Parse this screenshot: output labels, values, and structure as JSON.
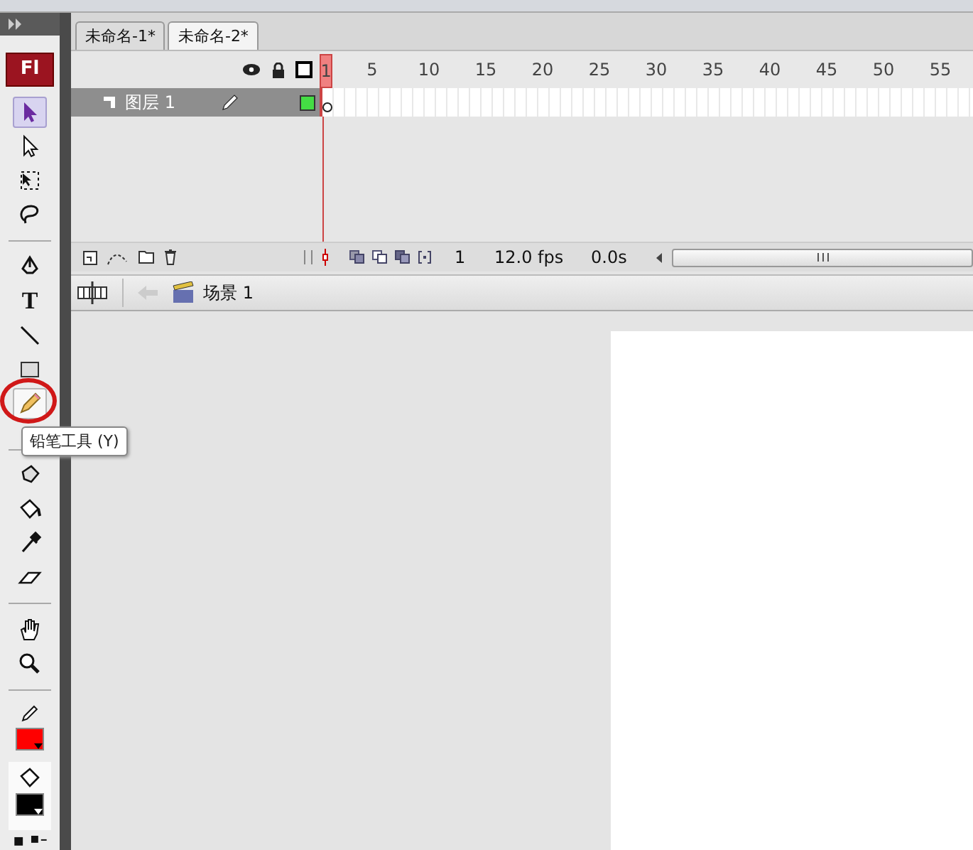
{
  "app_logo": "Fl",
  "tabs": [
    {
      "label": "未命名-1*",
      "selected": false
    },
    {
      "label": "未命名-2*",
      "selected": true
    }
  ],
  "timeline": {
    "frame_numbers": [
      "1",
      "5",
      "10",
      "15",
      "20",
      "25",
      "30",
      "35",
      "40",
      "45",
      "50",
      "55"
    ],
    "layers": [
      {
        "name": "图层 1",
        "selected": true,
        "color": "#44dd44"
      }
    ],
    "current_frame": "1",
    "frame_rate": "12.0 fps",
    "elapsed_time": "0.0s"
  },
  "scene": {
    "name": "场景 1"
  },
  "tools": [
    {
      "kind": "arrow",
      "selected": true
    },
    {
      "kind": "subselect",
      "selected": false
    },
    {
      "kind": "transform",
      "selected": false
    },
    {
      "kind": "lasso",
      "selected": false
    },
    {
      "kind": "divider"
    },
    {
      "kind": "pen",
      "selected": false
    },
    {
      "kind": "text",
      "selected": false,
      "label": "T"
    },
    {
      "kind": "line",
      "selected": false
    },
    {
      "kind": "rect",
      "selected": false
    },
    {
      "kind": "pencil",
      "selected": false,
      "hovered": true,
      "circled": true
    },
    {
      "kind": "divider"
    },
    {
      "kind": "bone",
      "selected": false
    },
    {
      "kind": "bucket",
      "selected": false
    },
    {
      "kind": "dropper",
      "selected": false
    },
    {
      "kind": "eraser",
      "selected": false
    },
    {
      "kind": "divider"
    },
    {
      "kind": "hand",
      "selected": false
    },
    {
      "kind": "zoom",
      "selected": false
    }
  ],
  "tooltip": "铅笔工具 (Y)",
  "color_swatches": [
    {
      "kind": "stroke",
      "color": "#ff0000"
    },
    {
      "kind": "fill",
      "color": "#000000"
    }
  ]
}
